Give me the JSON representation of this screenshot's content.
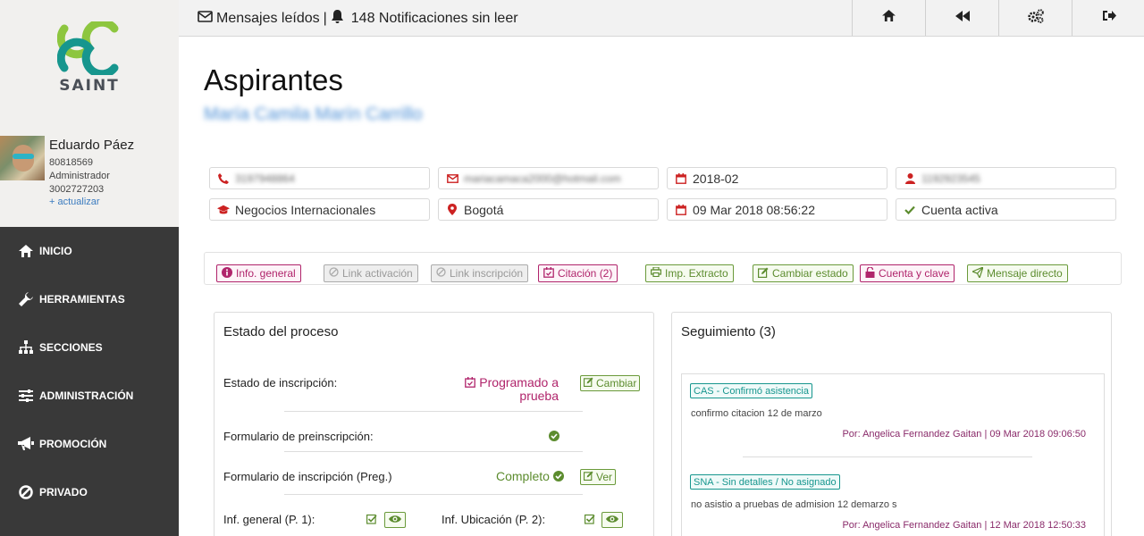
{
  "app": {
    "logo_text": "SAINT"
  },
  "profile": {
    "name": "Eduardo Páez",
    "id": "80818569",
    "role": "Administrador",
    "phone": "3002727203",
    "update_link": "+ actualizar"
  },
  "menu": [
    {
      "label": "INICIO",
      "icon": "home-icon"
    },
    {
      "label": "HERRAMIENTAS",
      "icon": "wrench-icon"
    },
    {
      "label": "SECCIONES",
      "icon": "sitemap-icon"
    },
    {
      "label": "ADMINISTRACIÓN",
      "icon": "sliders-icon"
    },
    {
      "label": "PROMOCIÓN",
      "icon": "megaphone-icon"
    },
    {
      "label": "PRIVADO",
      "icon": "ban-icon"
    }
  ],
  "topbar": {
    "messages": "Mensajes leídos",
    "separator": "|",
    "notifications": "148 Notificaciones sin leer"
  },
  "page": {
    "title": "Aspirantes",
    "subtitle": "María Camila Marín Carrillo"
  },
  "fields": {
    "phone": "3197948864",
    "email": "mariacamaca2000@hotmail.com",
    "period": "2018-02",
    "document": "1192923545",
    "program": "Negocios Internacionales",
    "city": "Bogotá",
    "date": "09 Mar 2018 08:56:22",
    "account": "Cuenta activa"
  },
  "actions": {
    "info": "Info. general",
    "link_activacion": "Link activación",
    "link_inscripcion": "Link inscripción",
    "citacion": "Citación (2)",
    "imp_extracto": "Imp. Extracto",
    "cambiar_estado": "Cambiar estado",
    "cuenta_clave": "Cuenta y clave",
    "mensaje": "Mensaje directo"
  },
  "process": {
    "title": "Estado del proceso",
    "estado_label": "Estado de inscripción:",
    "estado_value_1": "Programado a",
    "estado_value_2": "prueba",
    "cambiar": "Cambiar",
    "preinscripcion": "Formulario de preinscripción:",
    "inscripcion": "Formulario de inscripción (Preg.)",
    "completo": "Completo",
    "ver": "Ver",
    "inf_general": "Inf. general (P. 1):",
    "inf_ubicacion": "Inf. Ubicación (P. 2):"
  },
  "followup": {
    "title": "Seguimiento (3)",
    "entries": [
      {
        "tag": "CAS - Confirmó asistencia",
        "note": "confirmo citacion 12 de marzo",
        "by": "Por: Angelica Fernandez Gaitan | 09 Mar 2018 09:06:50"
      },
      {
        "tag": "SNA - Sin detalles / No asignado",
        "note": "no asistio a pruebas de admision 12 demarzo s",
        "by": "Por: Angelica Fernandez Gaitan | 12 Mar 2018 12:50:33"
      }
    ]
  },
  "colors": {
    "pink": "#b0246b",
    "green": "#5c8c2e",
    "teal": "#17968e",
    "sidebar_dark": "#393939"
  }
}
